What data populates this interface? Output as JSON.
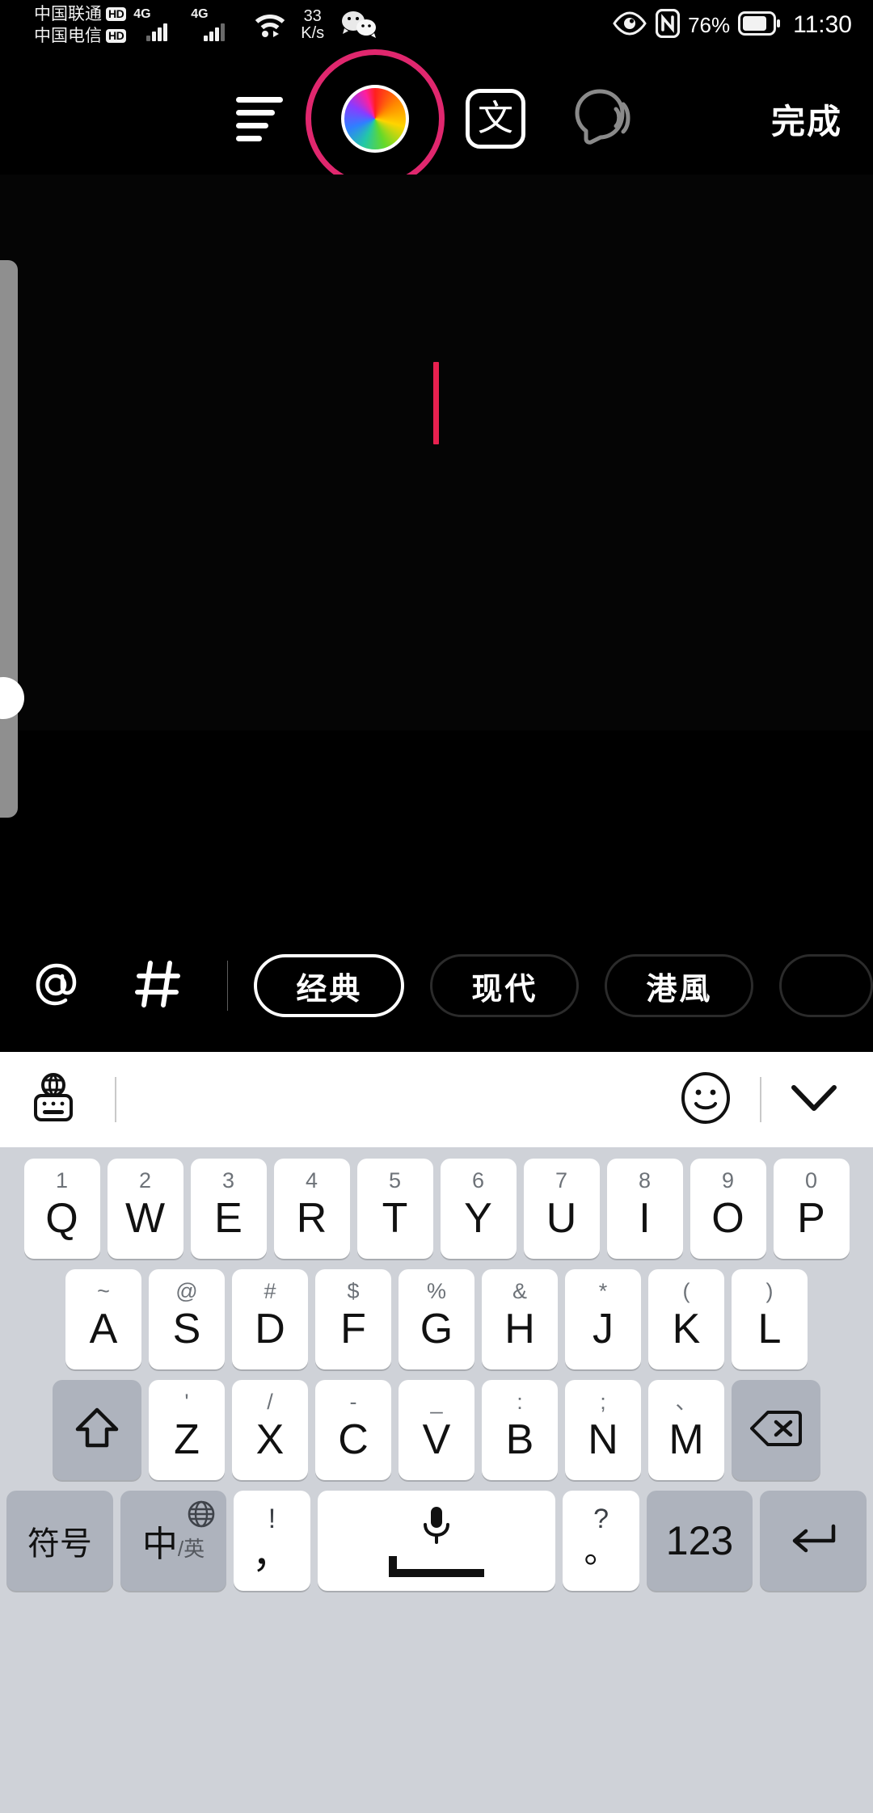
{
  "status_bar": {
    "carrier_1": "中国联通",
    "carrier_1_badge": "HD",
    "carrier_2": "中国电信",
    "carrier_2_badge": "HD",
    "network_1": "4G",
    "network_2": "4G",
    "net_speed_value": "33",
    "net_speed_unit": "K/s",
    "battery_percent": "76%",
    "clock": "11:30",
    "icons": [
      "wifi-icon",
      "wechat-icon",
      "eye-comfort-icon",
      "nfc-icon",
      "battery-icon"
    ]
  },
  "edit_toolbar": {
    "align_icon": "text-align-icon",
    "color_icon": "color-wheel-icon",
    "text_style_label": "文",
    "speech_icon": "text-to-speech-icon",
    "done_label": "完成"
  },
  "canvas": {
    "caret_color": "#e8214f",
    "text_value": ""
  },
  "style_bar": {
    "mention_icon": "at-icon",
    "hashtag_icon": "hash-icon",
    "styles": [
      {
        "label": "经典",
        "selected": true,
        "font": "sans"
      },
      {
        "label": "现代",
        "selected": false,
        "font": "sans"
      },
      {
        "label": "港風",
        "selected": false,
        "font": "serif"
      }
    ]
  },
  "keyboard_toolbar": {
    "language_icon": "globe-keyboard-icon",
    "emoji_icon": "emoji-smiley-icon",
    "collapse_icon": "chevron-down-icon"
  },
  "keyboard": {
    "row1": [
      {
        "main": "Q",
        "sup": "1"
      },
      {
        "main": "W",
        "sup": "2"
      },
      {
        "main": "E",
        "sup": "3"
      },
      {
        "main": "R",
        "sup": "4"
      },
      {
        "main": "T",
        "sup": "5"
      },
      {
        "main": "Y",
        "sup": "6"
      },
      {
        "main": "U",
        "sup": "7"
      },
      {
        "main": "I",
        "sup": "8"
      },
      {
        "main": "O",
        "sup": "9"
      },
      {
        "main": "P",
        "sup": "0"
      }
    ],
    "row2": [
      {
        "main": "A",
        "sup": "~"
      },
      {
        "main": "S",
        "sup": "@"
      },
      {
        "main": "D",
        "sup": "#"
      },
      {
        "main": "F",
        "sup": "$"
      },
      {
        "main": "G",
        "sup": "%"
      },
      {
        "main": "H",
        "sup": "&"
      },
      {
        "main": "J",
        "sup": "*"
      },
      {
        "main": "K",
        "sup": "("
      },
      {
        "main": "L",
        "sup": ")"
      }
    ],
    "row3": [
      {
        "main": "Z",
        "sup": "'"
      },
      {
        "main": "X",
        "sup": "/"
      },
      {
        "main": "C",
        "sup": "-"
      },
      {
        "main": "V",
        "sup": "_"
      },
      {
        "main": "B",
        "sup": ":"
      },
      {
        "main": "N",
        "sup": ";"
      },
      {
        "main": "M",
        "sup": "、"
      }
    ],
    "shift_icon": "shift-icon",
    "backspace_icon": "backspace-icon",
    "row4": {
      "symbols_label": "符号",
      "lang_main": "中",
      "lang_sub": "/英",
      "lang_globe_icon": "globe-icon",
      "comma_top": "!",
      "comma_main": "，",
      "space_icon": "microphone-icon",
      "period_top": "?",
      "period_main": "。",
      "numeric_label": "123",
      "enter_icon": "enter-icon"
    }
  }
}
